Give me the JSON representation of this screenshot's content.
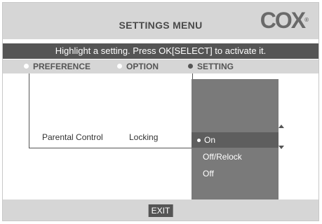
{
  "header": {
    "title": "SETTINGS MENU",
    "logo_text": "COX",
    "logo_tm": "®"
  },
  "instruction": "Highlight a setting. Press OK[SELECT] to activate it.",
  "breadcrumb": {
    "items": [
      "PREFERENCE",
      "OPTION",
      "SETTING"
    ],
    "active_index": 2
  },
  "row": {
    "preference": "Parental Control",
    "option": "Locking"
  },
  "settings": {
    "options": [
      "On",
      "Off/Relock",
      "Off"
    ],
    "selected_index": 0
  },
  "footer": {
    "exit_label": "EXIT"
  },
  "colors": {
    "header_bg": "#d6d6d6",
    "bar_dark": "#555555",
    "panel": "#7a7a7a",
    "panel_selected": "#5e5e5e"
  }
}
